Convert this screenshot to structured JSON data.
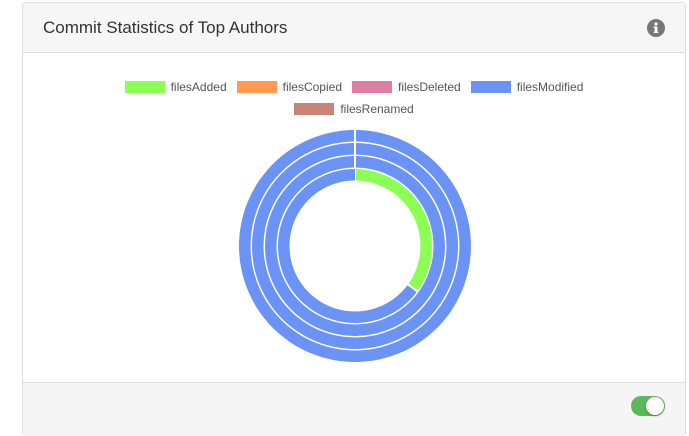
{
  "panel": {
    "title": "Commit Statistics of Top Authors",
    "info_icon": "info-circle-icon",
    "toggle_state": "on",
    "toggle_color": "#5cb85c"
  },
  "chart_data": {
    "type": "pie",
    "subtype": "multi-ring doughnut",
    "legend_position": "top",
    "legend": [
      {
        "name": "filesAdded",
        "color": "#8cff55"
      },
      {
        "name": "filesCopied",
        "color": "#ff9a50"
      },
      {
        "name": "filesDeleted",
        "color": "#dd7fa5"
      },
      {
        "name": "filesModified",
        "color": "#6b93f5"
      },
      {
        "name": "filesRenamed",
        "color": "#c98476"
      }
    ],
    "rings": [
      {
        "values": {
          "filesAdded": 0,
          "filesCopied": 0,
          "filesDeleted": 0,
          "filesModified": 100,
          "filesRenamed": 0
        }
      },
      {
        "values": {
          "filesAdded": 0,
          "filesCopied": 0,
          "filesDeleted": 0,
          "filesModified": 100,
          "filesRenamed": 0
        }
      },
      {
        "values": {
          "filesAdded": 0,
          "filesCopied": 0,
          "filesDeleted": 0,
          "filesModified": 100,
          "filesRenamed": 0
        }
      },
      {
        "values": {
          "filesAdded": 35,
          "filesCopied": 0,
          "filesDeleted": 0,
          "filesModified": 65,
          "filesRenamed": 0
        }
      }
    ]
  }
}
